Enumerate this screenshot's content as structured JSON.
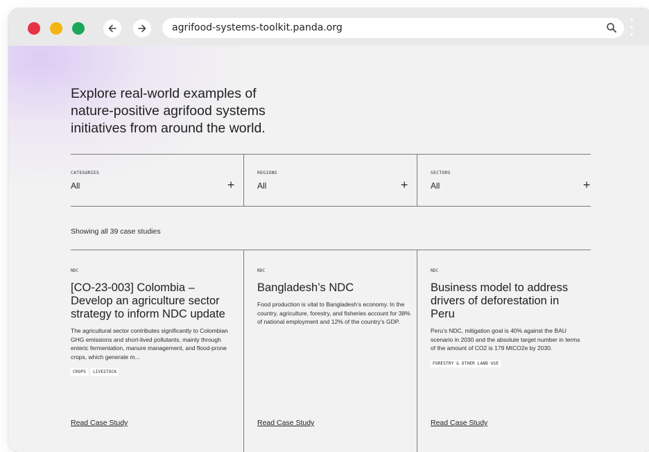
{
  "browser": {
    "url": "agrifood-systems-toolkit.panda.org"
  },
  "hero": {
    "line1": "Explore real-world examples of",
    "line2": "nature-positive agrifood systems",
    "line3": "initiatives from around the world."
  },
  "filters": [
    {
      "label": "CATEGORIES",
      "value": "All",
      "icon": "+"
    },
    {
      "label": "REGIONS",
      "value": "All",
      "icon": "+"
    },
    {
      "label": "SECTORS",
      "value": "All",
      "icon": "+"
    }
  ],
  "results": {
    "count_text": "Showing all 39 case studies"
  },
  "cards": [
    {
      "tag": "NDC",
      "title": "[CO-23-003] Colombia – Develop an agriculture sector strategy to inform NDC update",
      "description": "The agricultural sector contributes significantly to Colombian GHG emissions and short-lived pollutants, mainly through enteric fermentation, manure management, and flood-prone crops, which generate m...",
      "chips": [
        "CROPS",
        "LIVESTOCK"
      ],
      "link": "Read Case Study"
    },
    {
      "tag": "NDC",
      "title": "Bangladesh’s NDC",
      "description": "Food production is vital to Bangladesh’s economy. In the country, agriculture, forestry, and fisheries account for 38% of national employment and 12% of the country’s GDP.",
      "chips": [],
      "link": "Read Case Study"
    },
    {
      "tag": "NDC",
      "title": "Business model to address drivers of deforestation in Peru",
      "description": "Peru’s NDC, mitigation goal is 40% against the BAU scenario in 2030 and the absolute target number in terms of the amount of CO2 is 179 MtCO2e by 2030.",
      "chips": [
        "FORESTRY & OTHER LAND USE"
      ],
      "link": "Read Case Study"
    }
  ]
}
